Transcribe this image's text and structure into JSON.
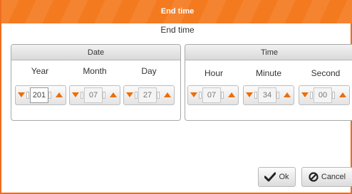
{
  "window": {
    "title": "End time"
  },
  "subtitle": "End time",
  "date_panel": {
    "header": "Date",
    "fields": [
      {
        "label": "Year",
        "value": "201"
      },
      {
        "label": "Month",
        "value": "07"
      },
      {
        "label": "Day",
        "value": "27"
      }
    ]
  },
  "time_panel": {
    "header": "Time",
    "fields": [
      {
        "label": "Hour",
        "value": "07"
      },
      {
        "label": "Minute",
        "value": "34"
      },
      {
        "label": "Second",
        "value": "00"
      }
    ]
  },
  "buttons": {
    "ok_label": "Ok",
    "cancel_label": "Cancel"
  },
  "colors": {
    "accent": "#f47a20",
    "arrow": "#ef6c00"
  },
  "icons": {
    "ok": "checkmark-icon",
    "cancel": "prohibited-icon",
    "up": "triangle-up-icon",
    "down": "triangle-down-icon"
  }
}
